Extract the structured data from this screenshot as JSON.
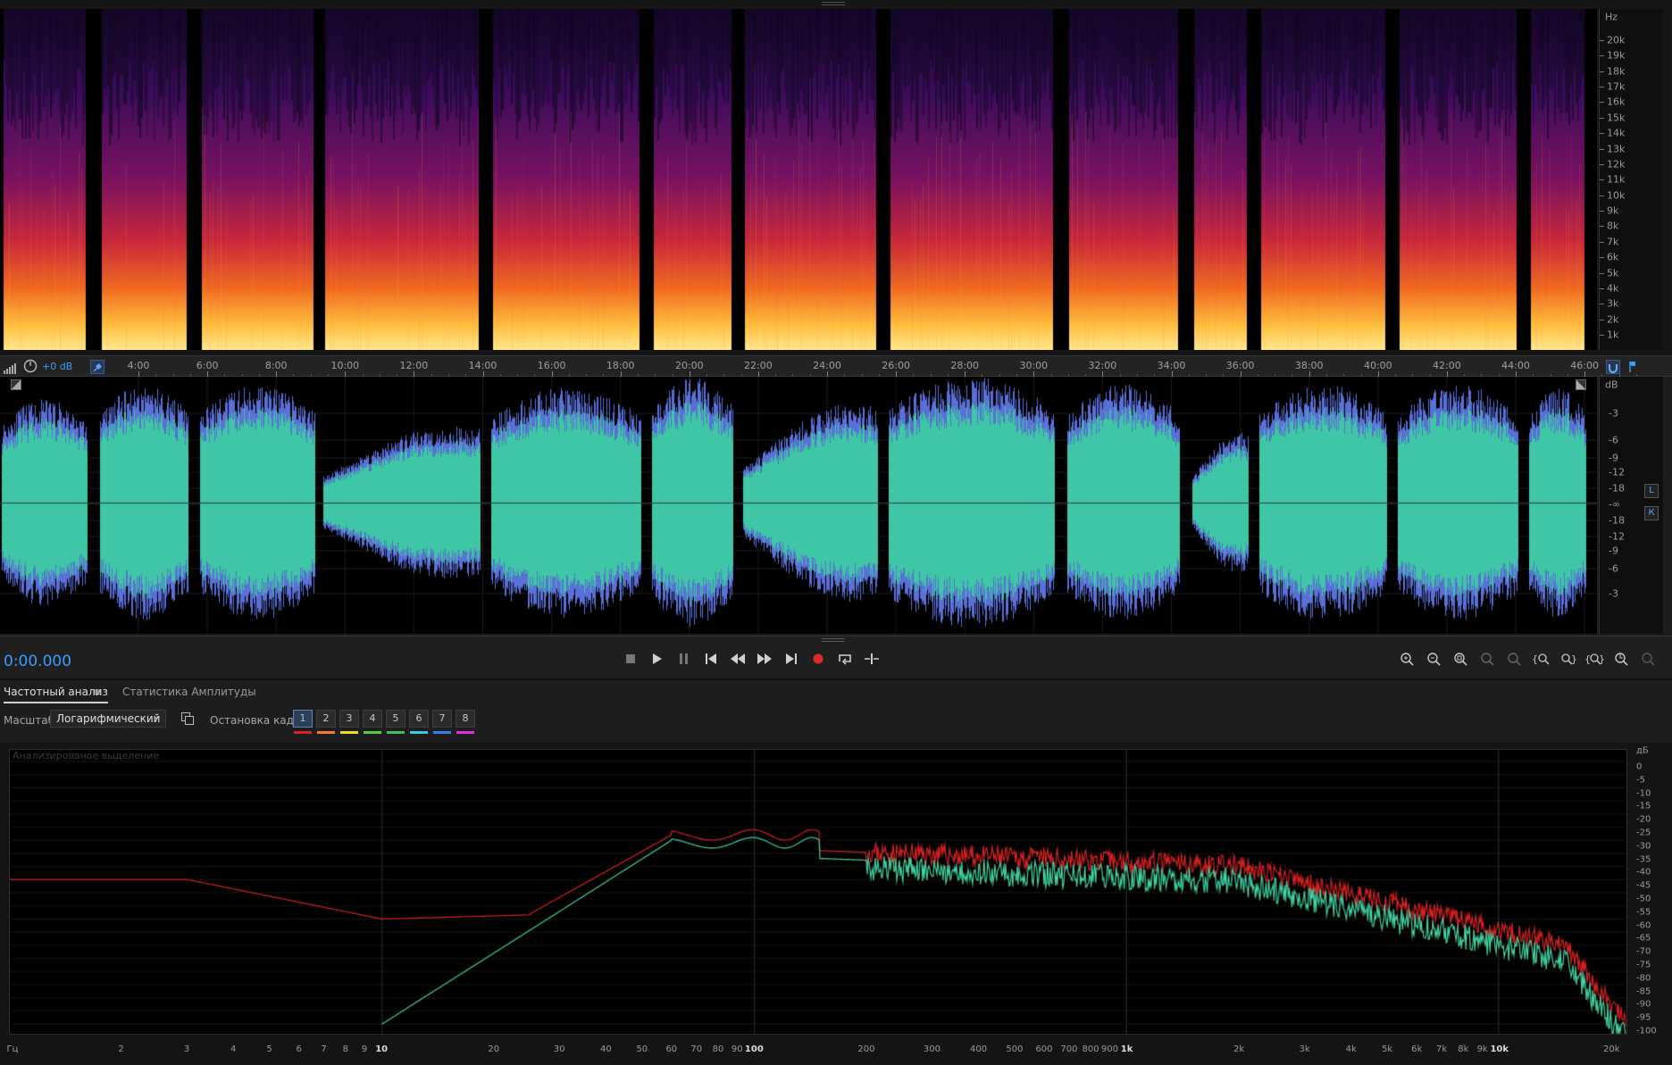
{
  "spectrogram": {
    "unit": "Hz",
    "freq_labels": [
      "20k",
      "19k",
      "18k",
      "17k",
      "16k",
      "15k",
      "14k",
      "13k",
      "12k",
      "11k",
      "10k",
      "9k",
      "8k",
      "7k",
      "6k",
      "5k",
      "4k",
      "3k",
      "2k",
      "1k"
    ]
  },
  "time_ruler": {
    "gain": "+0 dB",
    "labels": [
      "4:00",
      "6:00",
      "8:00",
      "10:00",
      "12:00",
      "14:00",
      "16:00",
      "18:00",
      "20:00",
      "22:00",
      "24:00",
      "26:00",
      "28:00",
      "30:00",
      "32:00",
      "34:00",
      "36:00",
      "38:00",
      "40:00",
      "42:00",
      "44:00",
      "46:00"
    ]
  },
  "waveform": {
    "unit": "dB",
    "db_labels": [
      "-3",
      "-6",
      "-9",
      "-12",
      "-18",
      "-∞",
      "-18",
      "-12",
      "-9",
      "-6",
      "-3"
    ],
    "channels": [
      "L",
      "К"
    ],
    "color": "#3fc6a6"
  },
  "transport": {
    "timecode": "0:00.000",
    "icons": [
      "stop-icon",
      "play-icon",
      "pause-icon",
      "skip-start-icon",
      "rewind-icon",
      "fast-forward-icon",
      "skip-end-icon",
      "record-icon",
      "loop-icon",
      "skip-selection-icon"
    ]
  },
  "tabs": [
    {
      "label": "Частотный анализ",
      "active": true
    },
    {
      "label": "Статистика Амплитуды",
      "active": false
    }
  ],
  "options": {
    "scale_label": "Масштаб:",
    "scale_value": "Логарифмический",
    "freeze_label": "Остановка кадра:",
    "frames": [
      "1",
      "2",
      "3",
      "4",
      "5",
      "6",
      "7",
      "8"
    ],
    "frame_colors": [
      "#e02020",
      "#f08020",
      "#e8e020",
      "#50d040",
      "#40c060",
      "#30d0e0",
      "#3080f0",
      "#e030e0"
    ]
  },
  "analyzer": {
    "title": "Анализированое выделение",
    "db_unit": "дБ",
    "db_labels": [
      "0",
      "-5",
      "-10",
      "-15",
      "-20",
      "-25",
      "-30",
      "-35",
      "-40",
      "-45",
      "-50",
      "-55",
      "-60",
      "-65",
      "-70",
      "-75",
      "-80",
      "-85",
      "-90",
      "-95",
      "-100"
    ],
    "hz_unit": "Гц",
    "hz_labels": [
      "2",
      "3",
      "4",
      "5",
      "6",
      "7",
      "8",
      "9",
      "10",
      "20",
      "30",
      "40",
      "50",
      "60",
      "70",
      "80",
      "90",
      "100",
      "200",
      "300",
      "400",
      "500",
      "600",
      "700",
      "800",
      "900",
      "1k",
      "2k",
      "3k",
      "4k",
      "5k",
      "6k",
      "7k",
      "8k",
      "9k",
      "10k",
      "20k"
    ],
    "colors": {
      "red": "#d42020",
      "green": "#3fd0a0"
    }
  }
}
